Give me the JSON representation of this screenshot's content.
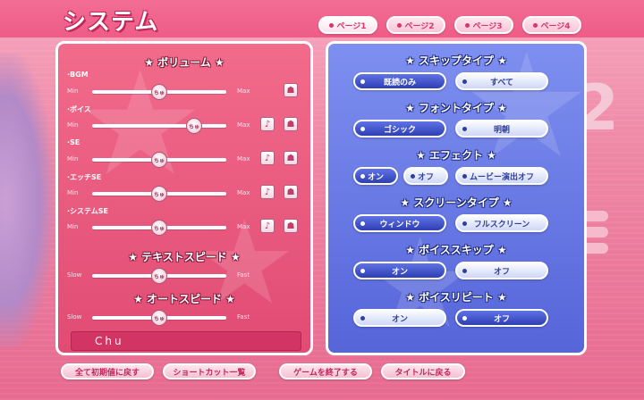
{
  "title": "システム",
  "tabs": [
    {
      "label": "ページ1",
      "active": true
    },
    {
      "label": "ページ2",
      "active": false
    },
    {
      "label": "ページ3",
      "active": false
    },
    {
      "label": "ページ4",
      "active": false
    }
  ],
  "volume": {
    "title": "★ ボリューム ★",
    "min_label": "Min",
    "max_label": "Max",
    "knob_text": "ちゅ",
    "note_icon": "♪",
    "test_icon": "☗",
    "channels": [
      {
        "label": "·BGM",
        "level": 0.5
      },
      {
        "label": "·ボイス",
        "level": 0.76
      },
      {
        "label": "·SE",
        "level": 0.5
      },
      {
        "label": "·エッチSE",
        "level": 0.5
      },
      {
        "label": "·システムSE",
        "level": 0.5
      }
    ]
  },
  "text_speed": {
    "title": "★ テキストスピード ★",
    "min_label": "Slow",
    "max_label": "Fast",
    "level": 0.5
  },
  "auto_speed": {
    "title": "★ オートスピード ★",
    "min_label": "Slow",
    "max_label": "Fast",
    "level": 0.5
  },
  "preview_text": "Chu",
  "skip_type": {
    "title": "★ スキップタイプ ★",
    "options": [
      {
        "label": "既読のみ",
        "selected": true
      },
      {
        "label": "すべて",
        "selected": false
      }
    ]
  },
  "font_type": {
    "title": "★ フォントタイプ ★",
    "options": [
      {
        "label": "ゴシック",
        "selected": true
      },
      {
        "label": "明朝",
        "selected": false
      }
    ]
  },
  "effect": {
    "title": "★ エフェクト ★",
    "options": [
      {
        "label": "オン",
        "selected": true
      },
      {
        "label": "オフ",
        "selected": false
      },
      {
        "label": "ムービー演出オフ",
        "selected": false
      }
    ]
  },
  "screen_type": {
    "title": "★ スクリーンタイプ ★",
    "options": [
      {
        "label": "ウィンドウ",
        "selected": true
      },
      {
        "label": "フルスクリーン",
        "selected": false
      }
    ]
  },
  "voice_skip": {
    "title": "★ ボイススキップ ★",
    "options": [
      {
        "label": "オン",
        "selected": true
      },
      {
        "label": "オフ",
        "selected": false
      }
    ]
  },
  "voice_repeat": {
    "title": "★ ボイスリピート ★",
    "options": [
      {
        "label": "オン",
        "selected": false
      },
      {
        "label": "オフ",
        "selected": true
      }
    ]
  },
  "bottom_buttons": [
    "全て初期値に戻す",
    "ショートカット一覧",
    "ゲームを終了する",
    "タイトルに戻る"
  ],
  "background_numeral": "2",
  "colors": {
    "pink": "#e14b74",
    "blue": "#5665d9",
    "accent": "#c2275a"
  }
}
